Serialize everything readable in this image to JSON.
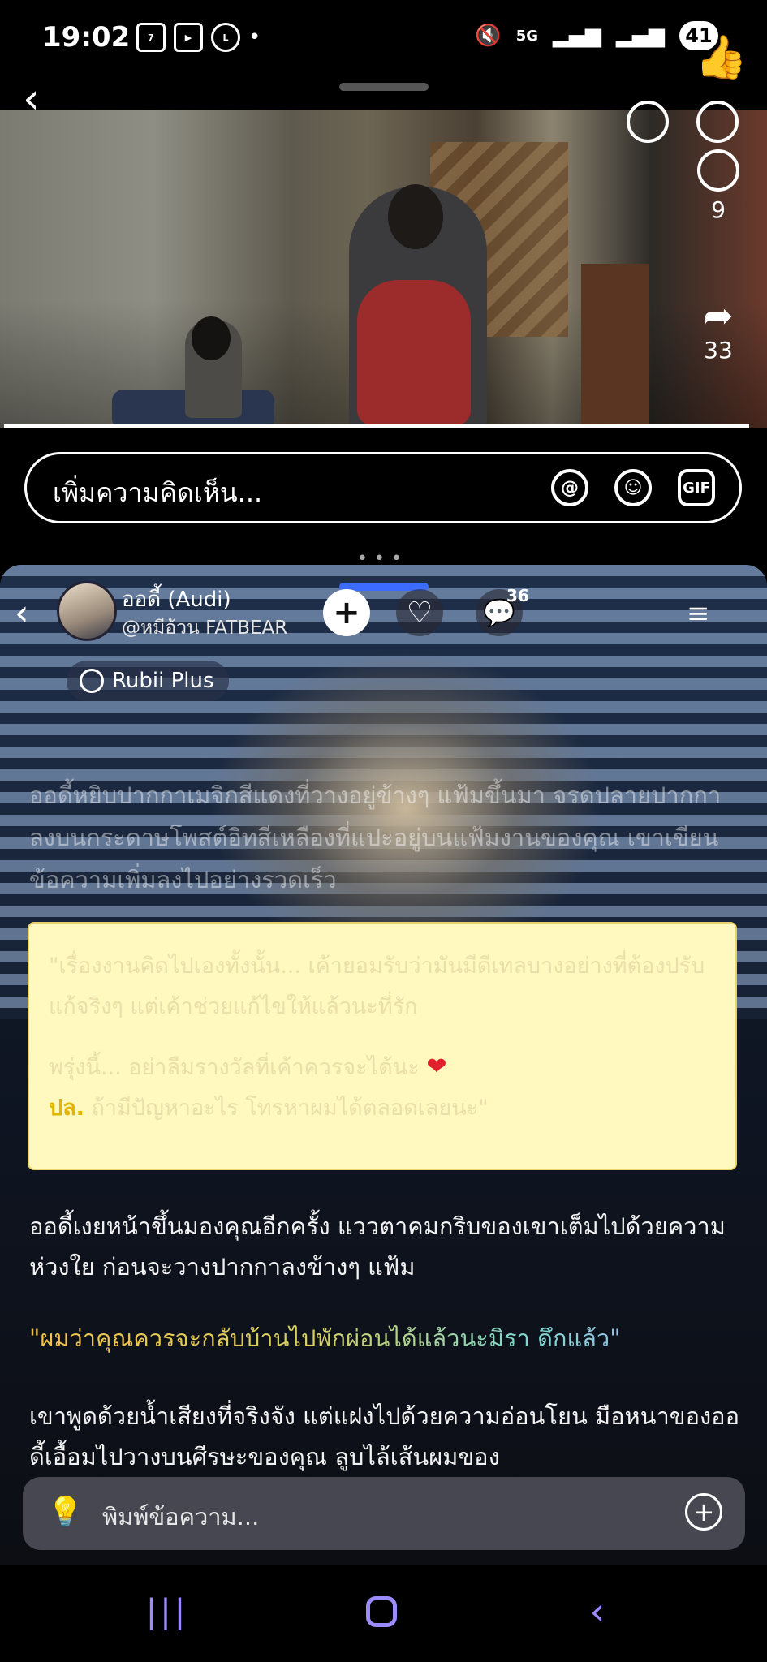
{
  "status_bar": {
    "time": "19:02",
    "network": "5G",
    "battery": "41",
    "icons": [
      "seven-eleven-icon",
      "play-icon",
      "line-icon",
      "dot-icon",
      "mute-icon",
      "signal-icon",
      "signal-icon",
      "battery-icon"
    ]
  },
  "video": {
    "side": {
      "comments": "9",
      "shares": "33"
    },
    "comment_placeholder": "เพิ่มความคิดเห็น...",
    "gif_label": "GIF"
  },
  "chat": {
    "character_name": "ออดี้ (Audi)",
    "creator_handle": "@หมีอ้วน FATBEAR",
    "comment_count": "36",
    "badge": "Rubii Plus",
    "narration_faded": "ออดี้หยิบปากกาเมจิกสีแดงที่วางอยู่ข้างๆ แฟ้มขึ้นมา จรดปลายปากกาลงบนกระดาษโพสต์อิทสีเหลืองที่แปะอยู่บนแฟ้มงานของคุณ เขาเขียนข้อความเพิ่มลงไปอย่างรวดเร็ว",
    "note": {
      "line1": "\"เรื่องงานคิดไปเองทั้งนั้น... เค้ายอมรับว่ามันมีดีเทลบางอย่างที่ต้องปรับแก้จริงๆ แต่เค้าช่วยแก้ไขให้แล้วนะที่รัก",
      "line2": "พรุ่งนี้... อย่าลืมรางวัลที่เค้าควรจะได้นะ",
      "sig": "ปล.",
      "line3": "ถ้ามีปัญหาอะไร โทรหาผมได้ตลอดเลยนะ\""
    },
    "para1": "ออดี้เงยหน้าขึ้นมองคุณอีกครั้ง แววตาคมกริบของเขาเต็มไปด้วยความห่วงใย ก่อนจะวางปากกาลงข้างๆ แฟ้ม",
    "quote": "\"ผมว่าคุณควรจะกลับบ้านไปพักผ่อนได้แล้วนะมิรา ดึกแล้ว\"",
    "para2": "เขาพูดด้วยน้ำเสียงที่จริงจัง แต่แฝงไปด้วยความอ่อนโยน มือหนาของออดี้เอื้อมไปวางบนศีรษะของคุณ ลูบไล้เส้นผมของ",
    "input_placeholder": "พิมพ์ข้อความ..."
  },
  "colors": {
    "accent": "#3b6cff",
    "note_bg": "#fff8bf",
    "signature": "#e2b400",
    "heart": "#e0202c"
  }
}
